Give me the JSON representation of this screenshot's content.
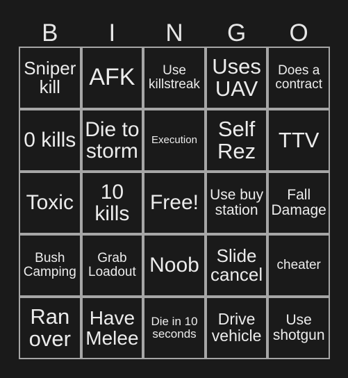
{
  "card": {
    "title": "BINGO",
    "headers": [
      "B",
      "I",
      "N",
      "G",
      "O"
    ],
    "colors": {
      "background": "#1a1a1a",
      "cell_background": "#1a1a1a",
      "cell_border": "#a6a6a6",
      "text": "#ececec",
      "header_text": "#e6e6e6"
    },
    "rows": [
      [
        {
          "text": "Sniper kill",
          "size": "fs-26"
        },
        {
          "text": "AFK",
          "size": "fs-34"
        },
        {
          "text": "Use killstreak",
          "size": "fs-19"
        },
        {
          "text": "Uses UAV",
          "size": "fs-31"
        },
        {
          "text": "Does a contract",
          "size": "fs-19"
        }
      ],
      [
        {
          "text": "0 kills",
          "size": "fs-30"
        },
        {
          "text": "Die to storm",
          "size": "fs-30"
        },
        {
          "text": "Execution",
          "size": "fs-15"
        },
        {
          "text": "Self Rez",
          "size": "fs-31"
        },
        {
          "text": "TTV",
          "size": "fs-31"
        }
      ],
      [
        {
          "text": "Toxic",
          "size": "fs-30"
        },
        {
          "text": "10 kills",
          "size": "fs-30"
        },
        {
          "text": "Free!",
          "size": "fs-30"
        },
        {
          "text": "Use buy station",
          "size": "fs-21"
        },
        {
          "text": "Fall Damage",
          "size": "fs-21"
        }
      ],
      [
        {
          "text": "Bush Camping",
          "size": "fs-19"
        },
        {
          "text": "Grab Loadout",
          "size": "fs-19"
        },
        {
          "text": "Noob",
          "size": "fs-30"
        },
        {
          "text": "Slide cancel",
          "size": "fs-26"
        },
        {
          "text": "cheater",
          "size": "fs-19"
        }
      ],
      [
        {
          "text": "Ran over",
          "size": "fs-31"
        },
        {
          "text": "Have Melee",
          "size": "fs-28"
        },
        {
          "text": "Die in 10 seconds",
          "size": "fs-17"
        },
        {
          "text": "Drive vehicle",
          "size": "fs-23"
        },
        {
          "text": "Use shotgun",
          "size": "fs-21"
        }
      ]
    ]
  }
}
